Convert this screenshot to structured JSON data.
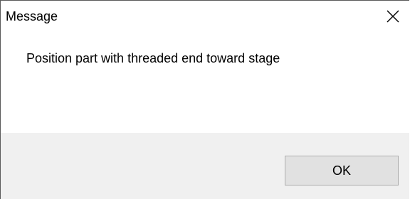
{
  "window": {
    "title": "Message",
    "close_icon": "close-icon"
  },
  "message": {
    "text": "Position part with threaded end toward stage"
  },
  "buttons": {
    "ok_label": "OK"
  }
}
